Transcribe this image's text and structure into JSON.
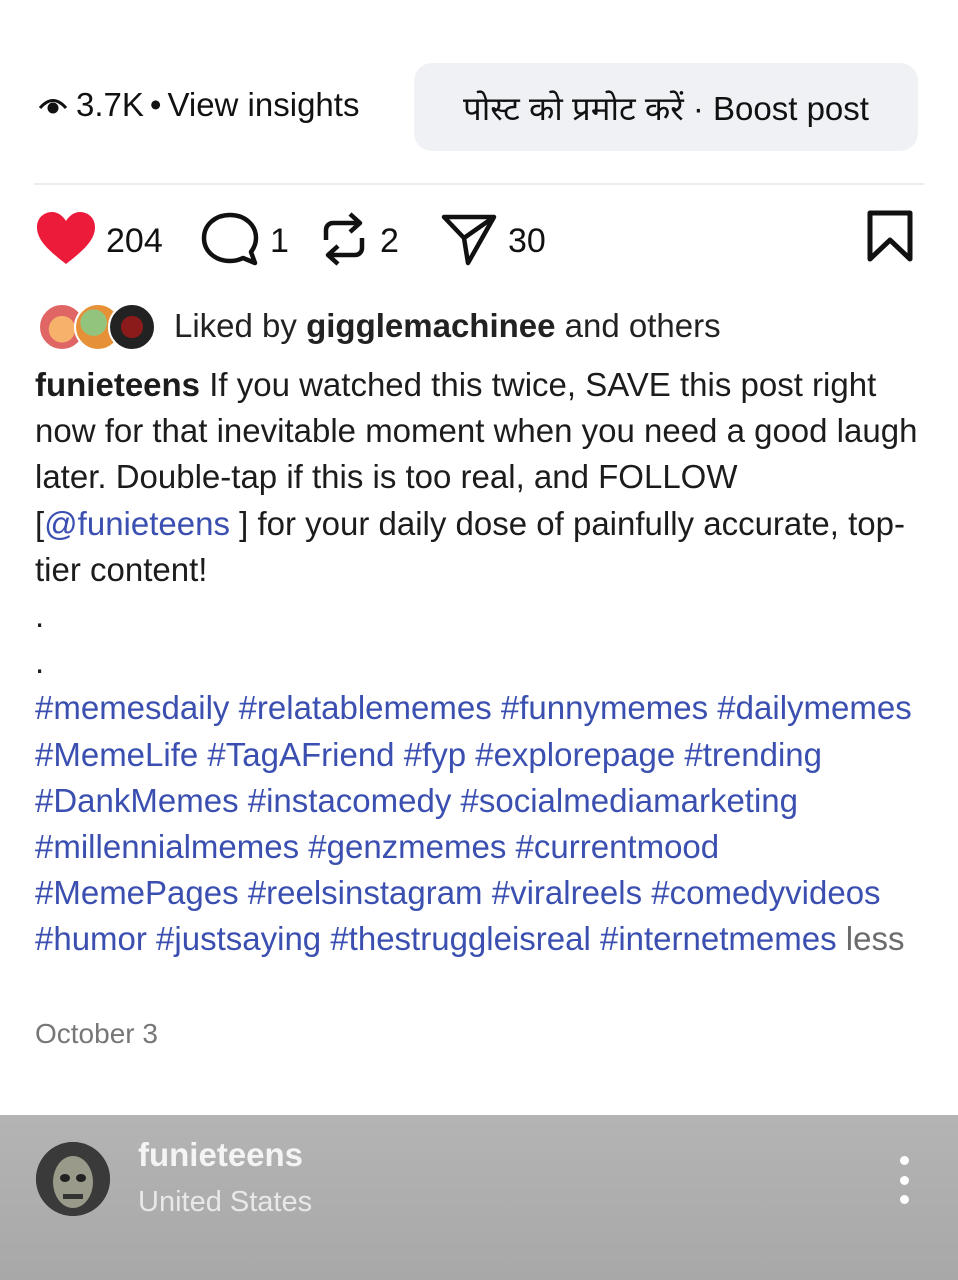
{
  "insights": {
    "views": "3.7K",
    "separator": "•",
    "link_label": "View insights",
    "icon": "eye-icon"
  },
  "boost_button": {
    "label": "पोस्ट को प्रमोट करें · Boost post"
  },
  "actions": {
    "likes": "204",
    "comments": "1",
    "reposts": "2",
    "shares": "30",
    "like_color": "#ed1b3a"
  },
  "liked_by": {
    "prefix": "Liked by",
    "user": "gigglemachinee",
    "suffix": "and others"
  },
  "caption": {
    "username": "funieteens",
    "text_1": "If you watched this twice, SAVE this post right now for that inevitable moment when you need a good laugh later. Double-tap if this is too real, and FOLLOW [",
    "mention": "@funieteens",
    "text_2": "] for your daily dose of painfully accurate, top-tier content!",
    "dot_1": ".",
    "dot_2": ".",
    "hashtags": "#memesdaily #relatablememes #funnymemes #dailymemes #MemeLife #TagAFriend #fyp #explorepage #trending #DankMemes #instacomedy #socialmediamarketing #millennialmemes #genzmemes #currentmood #MemePages #reelsinstagram #viralreels #comedyvideos #humor #justsaying #thestruggleisreal #internetmemes",
    "less_label": "less",
    "link_color": "#3a4fb0"
  },
  "date": "October 3",
  "bottom_bar": {
    "username": "funieteens",
    "location": "United States"
  }
}
